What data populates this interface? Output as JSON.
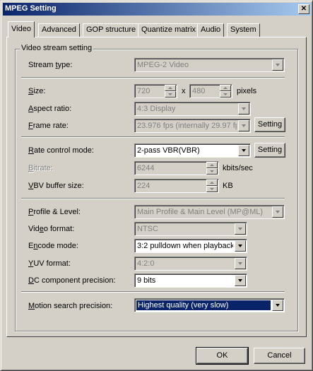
{
  "window": {
    "title": "MPEG Setting",
    "close_glyph": "✕"
  },
  "tabs": [
    "Video",
    "Advanced",
    "GOP structure",
    "Quantize matrix",
    "Audio",
    "System"
  ],
  "group_title": "Video stream setting",
  "fields": {
    "stream_type": {
      "label_pre": "Stream ",
      "label_key": "t",
      "label_post": "ype:",
      "value": "MPEG-2 Video"
    },
    "size": {
      "label_key": "S",
      "label_post": "ize:",
      "width": "720",
      "times": "x",
      "height": "480",
      "unit": "pixels"
    },
    "aspect_ratio": {
      "label_key": "A",
      "label_post": "spect ratio:",
      "value": "4:3 Display"
    },
    "frame_rate": {
      "label_key": "F",
      "label_post": "rame rate:",
      "value": "23.976 fps (internally 29.97 fps)",
      "button": "Setting"
    },
    "rate_control": {
      "label_key": "R",
      "label_post": "ate control mode:",
      "value": "2-pass VBR(VBR)",
      "button": "Setting"
    },
    "bitrate": {
      "label_key": "B",
      "label_post": "itrate:",
      "value": "6244",
      "unit": "kbits/sec"
    },
    "vbv_buffer": {
      "label_pre": "",
      "label_key": "V",
      "label_post": "BV buffer size:",
      "value": "224",
      "unit": "KB"
    },
    "profile_level": {
      "label_key": "P",
      "label_post": "rofile & Level:",
      "value": "Main Profile & Main Level (MP@ML)"
    },
    "video_format": {
      "label_pre": "Vid",
      "label_key": "e",
      "label_post": "o format:",
      "value": "NTSC"
    },
    "encode_mode": {
      "label_pre": "E",
      "label_key": "n",
      "label_post": "code mode:",
      "value": "3:2 pulldown when playback"
    },
    "yuv_format": {
      "label_key": "Y",
      "label_post": "UV format:",
      "value": "4:2:0"
    },
    "dc_precision": {
      "label_key": "D",
      "label_post": "C component precision:",
      "value": "9 bits"
    },
    "motion_search": {
      "label_key": "M",
      "label_post": "otion search precision:",
      "value": "Highest quality (very slow)"
    }
  },
  "buttons": {
    "ok": "OK",
    "cancel": "Cancel"
  }
}
